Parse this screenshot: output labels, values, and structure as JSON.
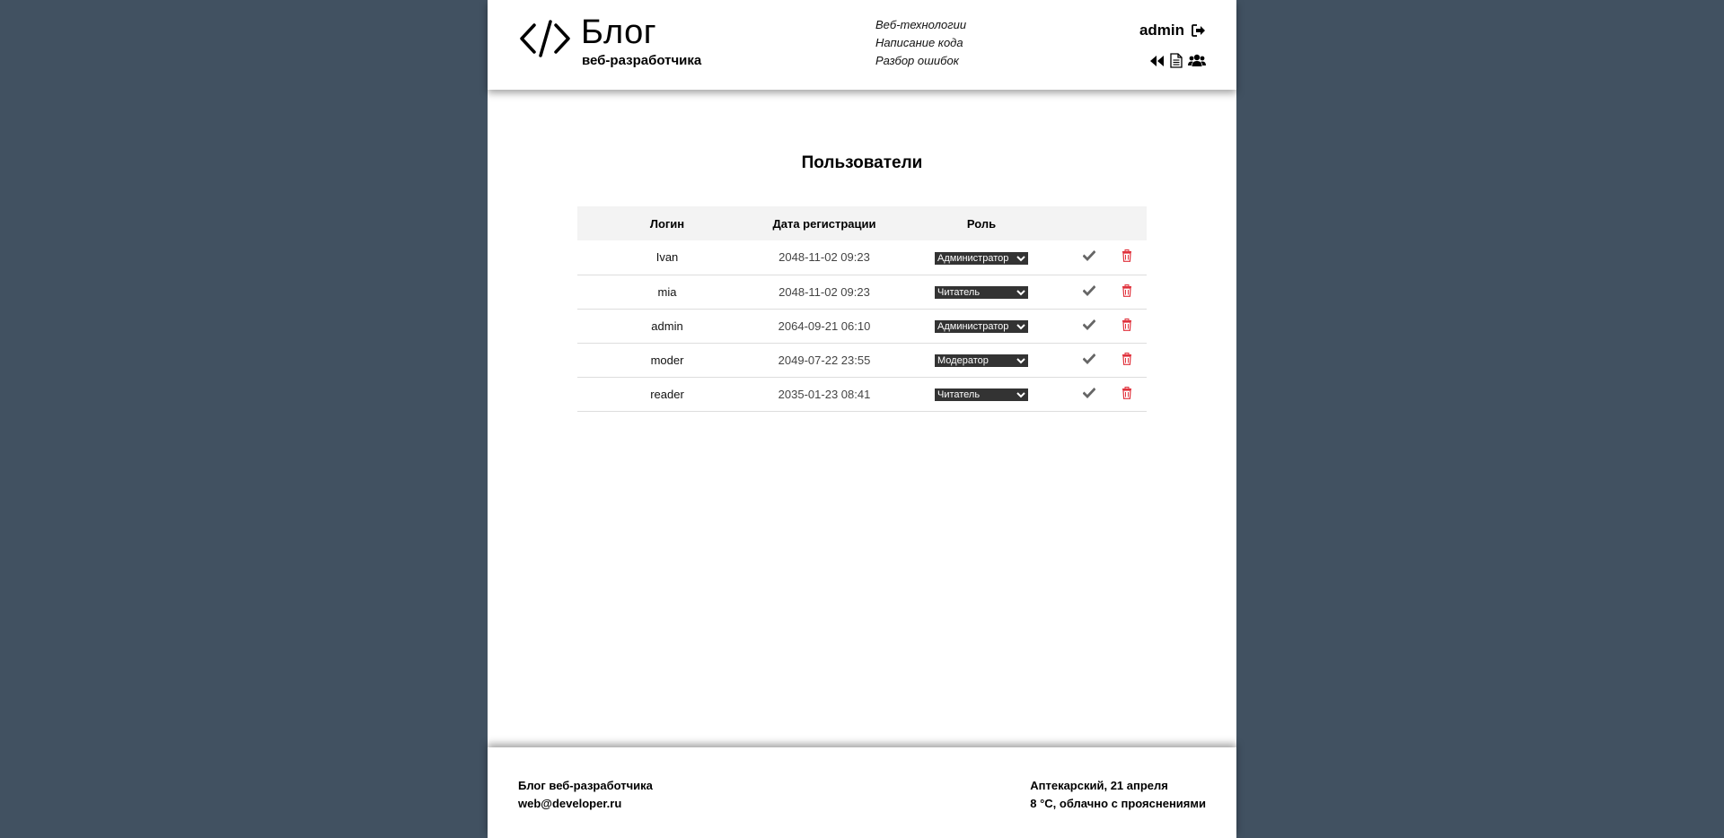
{
  "header": {
    "logo_title": "Блог",
    "logo_subtitle": "веб-разработчика",
    "nav": [
      "Веб-технологии",
      "Написание кода",
      "Разбор ошибок"
    ],
    "username": "admin"
  },
  "main": {
    "title": "Пользователи",
    "columns": [
      "Логин",
      "Дата регистрации",
      "Роль"
    ],
    "rows": [
      {
        "login": "Ivan",
        "date": "2048-11-02 09:23",
        "role": "Администратор"
      },
      {
        "login": "mia",
        "date": "2048-11-02 09:23",
        "role": "Читатель"
      },
      {
        "login": "admin",
        "date": "2064-09-21 06:10",
        "role": "Администратор"
      },
      {
        "login": "moder",
        "date": "2049-07-22 23:55",
        "role": "Модератор"
      },
      {
        "login": "reader",
        "date": "2035-01-23 08:41",
        "role": "Читатель"
      }
    ]
  },
  "footer": {
    "blog_name": "Блог веб-разработчика",
    "email": "web@developer.ru",
    "location": "Аптекарский, 21 апреля",
    "weather": "8 °C, облачно с прояснениями"
  },
  "colors": {
    "background": "#415161",
    "page": "#ffffff",
    "delete_icon": "#e0323c",
    "save_icon": "#666666",
    "select_bg": "#333333"
  }
}
